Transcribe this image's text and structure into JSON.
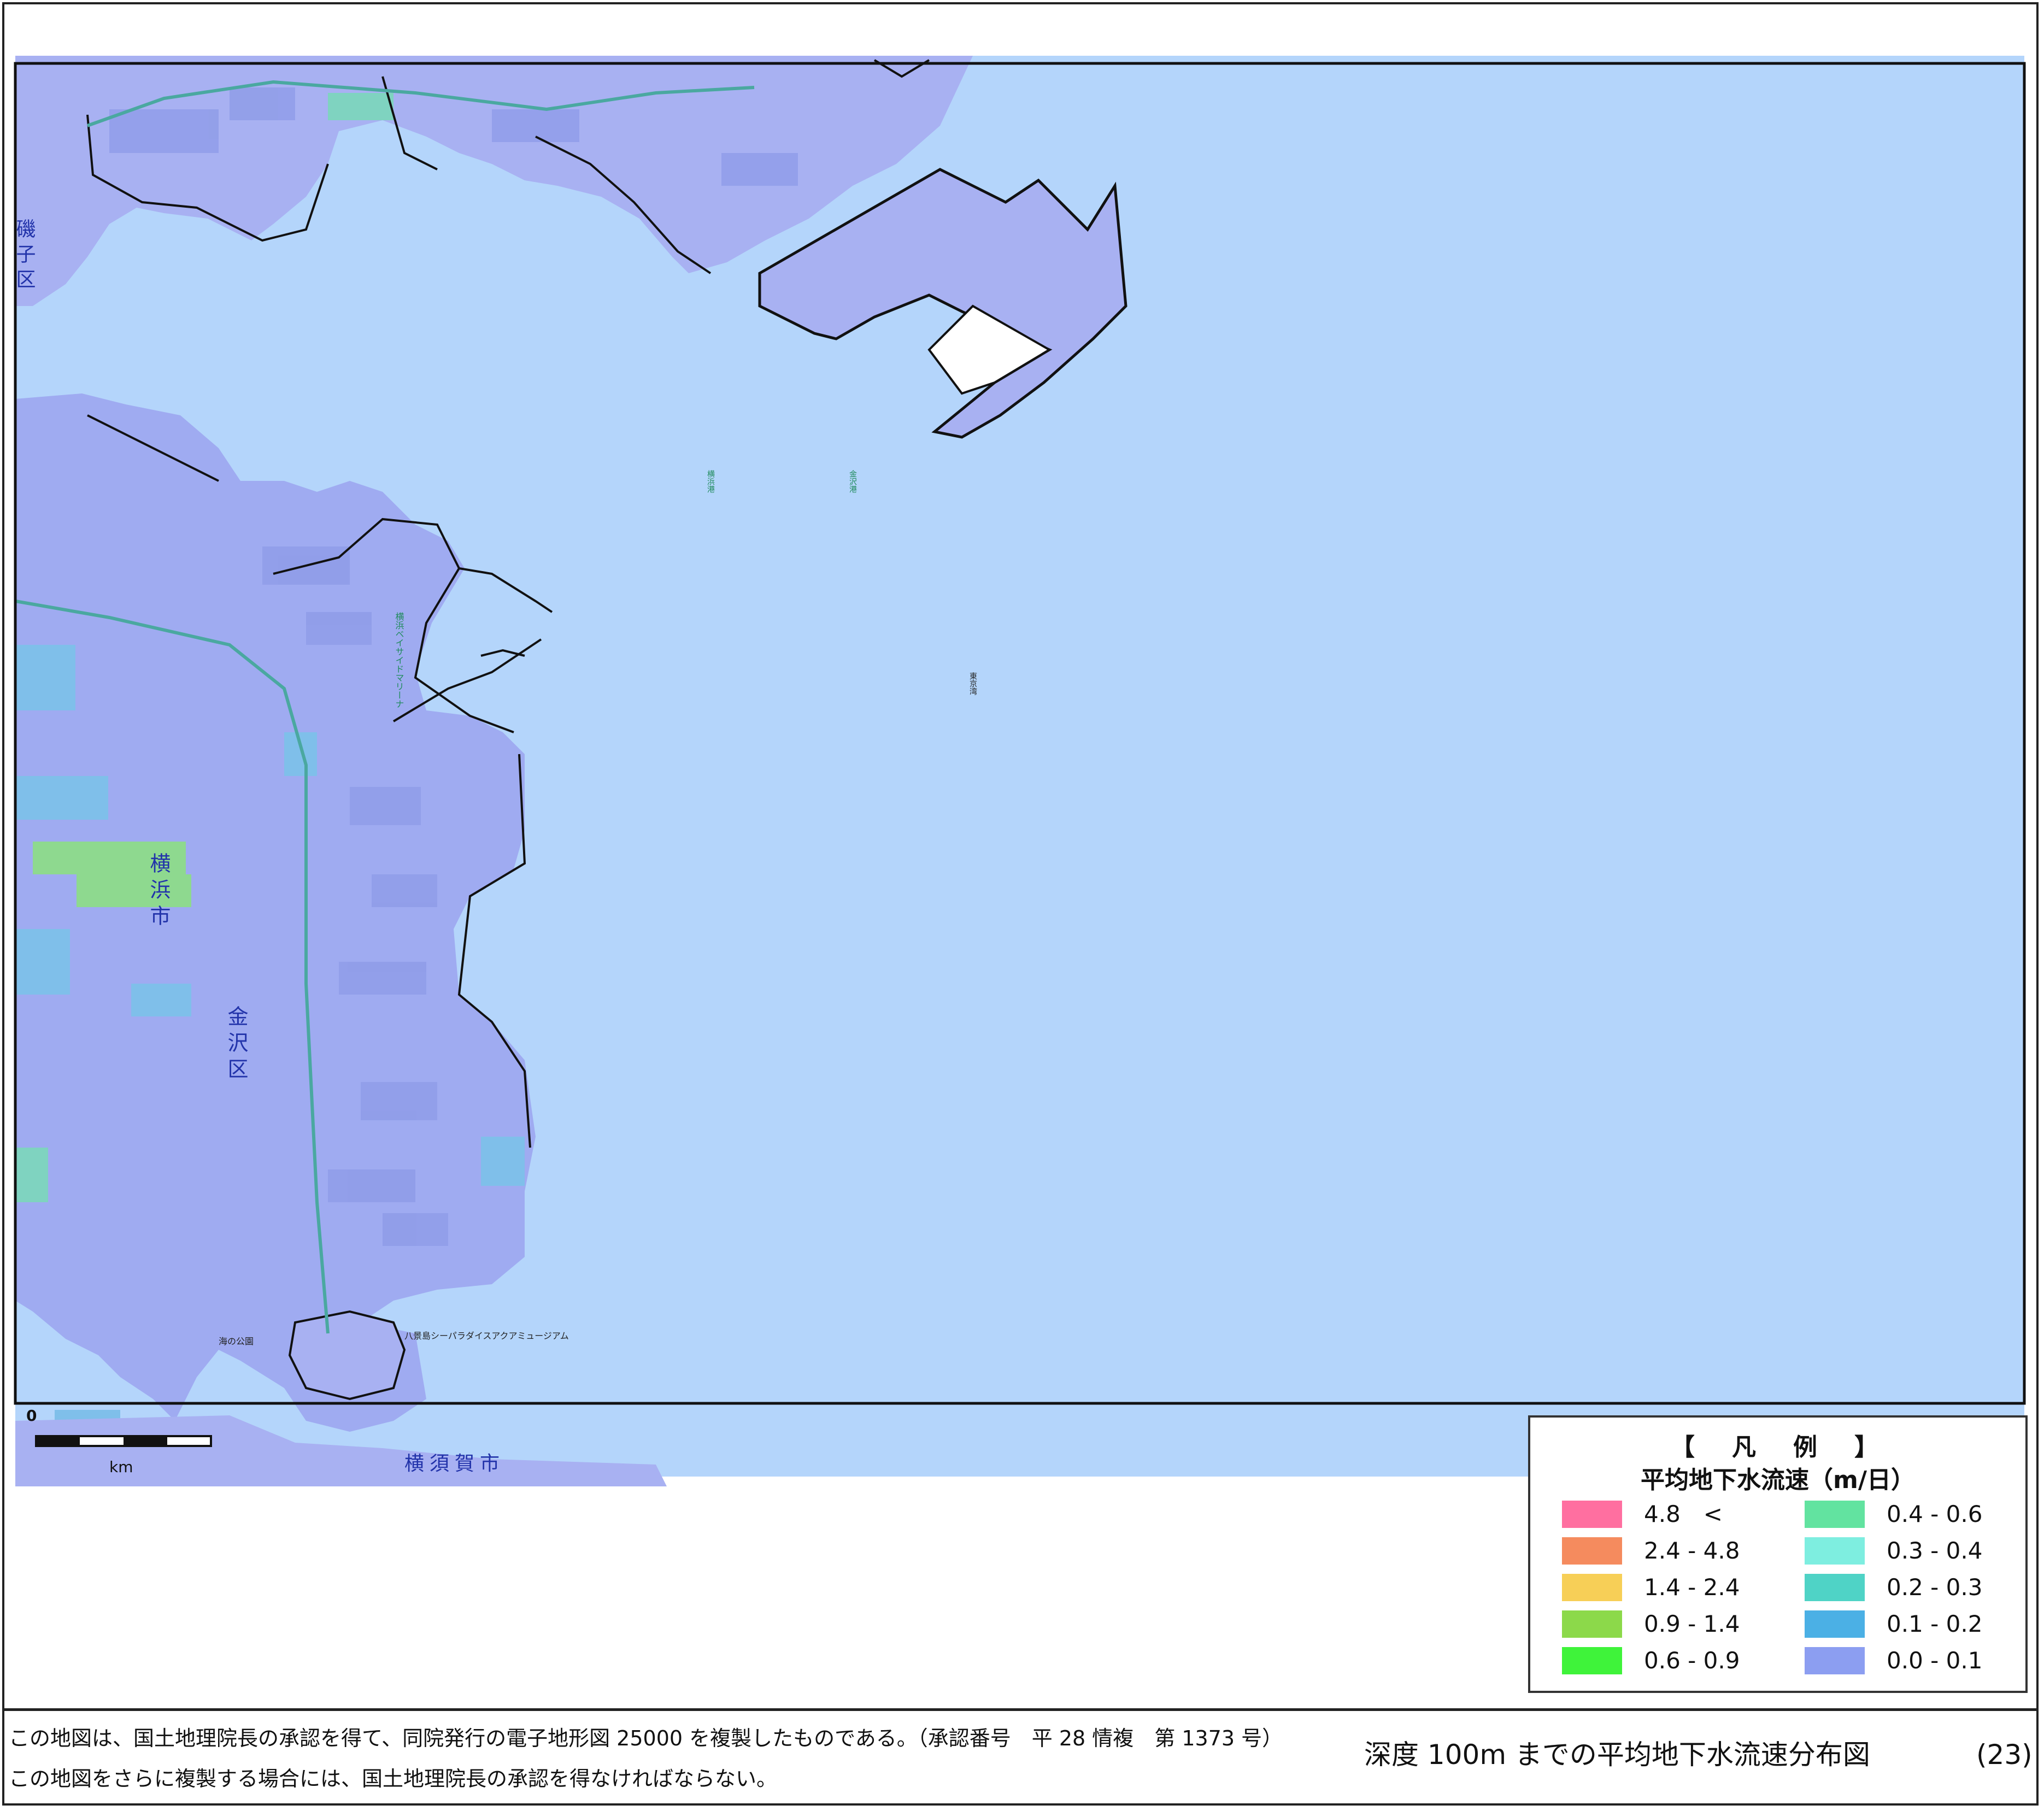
{
  "map": {
    "city_labels": {
      "yokohama_city": "横浜市",
      "kanazawa_ward": "金沢区",
      "isogo_ward": "磯子区",
      "yokosuka_city": "横須賀市"
    },
    "place_labels": {
      "hakkeijima": "八景島シーパラダイスアクアミュージアム",
      "umi_no_koen": "海の公園",
      "fudo_yokohama_ko": "横浜港",
      "fudo_kanzawa": "金沢港",
      "tokyo_bay": "東京湾",
      "marina": "横浜ベイサイドマリーナ"
    },
    "scale_bar": {
      "zero_label": "0",
      "unit_label": "km"
    },
    "colors": {
      "sea": "#b4d5fb",
      "land_low": "#a8b1f2",
      "land_mid": "#9aa8f0",
      "cell_blue": "#7fbfea",
      "cell_green": "#8ed98f",
      "reclaimed_white": "#ffffff",
      "outline": "#111111",
      "railway": "#4aa8a0"
    }
  },
  "legend": {
    "title": "【　凡　例　】",
    "subtitle": "平均地下水流速（m/日）",
    "items": [
      {
        "label": "4.8　<",
        "color": "#ff6fa0"
      },
      {
        "label": "2.4 - 4.8",
        "color": "#f58b5e"
      },
      {
        "label": "1.4 - 2.4",
        "color": "#f7cf57"
      },
      {
        "label": "0.9 - 1.4",
        "color": "#8cd94a"
      },
      {
        "label": "0.6 - 0.9",
        "color": "#3ff33a"
      },
      {
        "label": "0.4 - 0.6",
        "color": "#62e3a0"
      },
      {
        "label": "0.3 - 0.4",
        "color": "#7eeee0"
      },
      {
        "label": "0.2 - 0.3",
        "color": "#4fd3c6"
      },
      {
        "label": "0.1 - 0.2",
        "color": "#4bb0e5"
      },
      {
        "label": "0.0 - 0.1",
        "color": "#8c9ef1"
      }
    ]
  },
  "footer": {
    "line1": "この地図は、国土地理院長の承認を得て、同院発行の電子地形図 25000 を複製したものである。（承認番号　平 28 情複　第 1373 号）",
    "line2": "この地図をさらに複製する場合には、国土地理院長の承認を得なければならない。",
    "map_title": "深度 100m までの平均地下水流速分布図",
    "sheet_no": "(23)"
  }
}
